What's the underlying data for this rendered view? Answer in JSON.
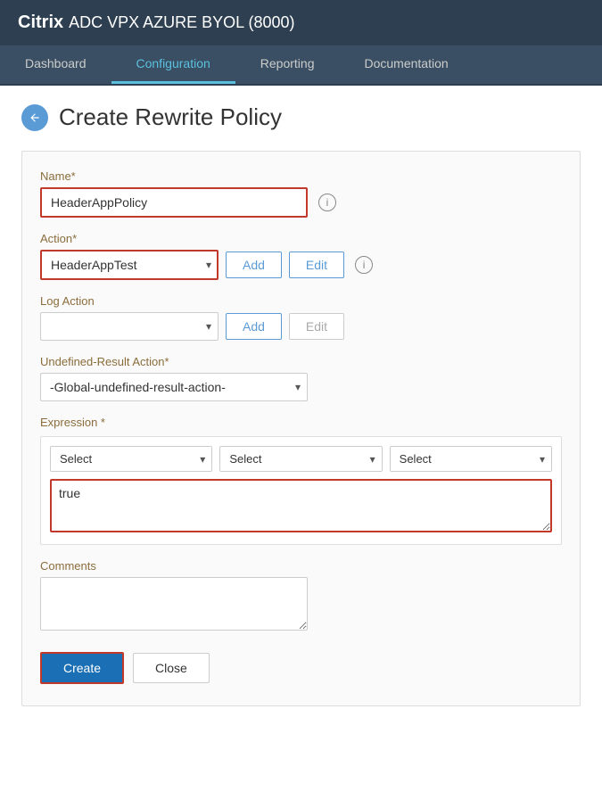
{
  "header": {
    "brand_citrix": "Citrix",
    "brand_rest": "ADC VPX AZURE BYOL (8000)"
  },
  "nav": {
    "tabs": [
      {
        "id": "dashboard",
        "label": "Dashboard",
        "active": false
      },
      {
        "id": "configuration",
        "label": "Configuration",
        "active": true
      },
      {
        "id": "reporting",
        "label": "Reporting",
        "active": false
      },
      {
        "id": "documentation",
        "label": "Documentation",
        "active": false
      }
    ]
  },
  "page": {
    "title": "Create Rewrite Policy",
    "back_icon": "←"
  },
  "form": {
    "name_label": "Name*",
    "name_value": "HeaderAppPolicy",
    "name_placeholder": "",
    "action_label": "Action*",
    "action_value": "HeaderAppTest",
    "action_add_label": "Add",
    "action_edit_label": "Edit",
    "log_action_label": "Log Action",
    "log_action_value": "",
    "log_add_label": "Add",
    "log_edit_label": "Edit",
    "undefined_result_label": "Undefined-Result Action*",
    "undefined_result_value": "-Global-undefined-result-action-",
    "expression_label": "Expression *",
    "expression_select1_placeholder": "Select",
    "expression_select2_placeholder": "Select",
    "expression_select3_placeholder": "Select",
    "expression_textarea_value": "true",
    "comments_label": "Comments",
    "comments_placeholder": "",
    "create_label": "Create",
    "close_label": "Close"
  }
}
